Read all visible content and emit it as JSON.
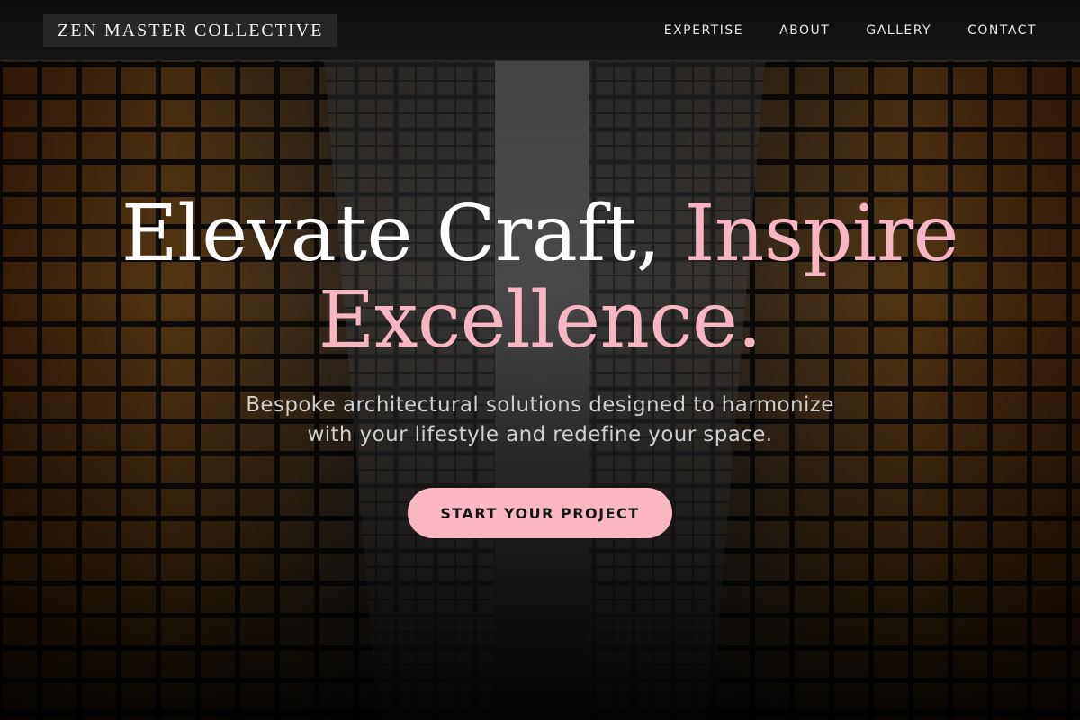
{
  "brand": {
    "name": "ZEN MASTER COLLECTIVE"
  },
  "nav": {
    "items": [
      {
        "label": "EXPERTISE"
      },
      {
        "label": "ABOUT"
      },
      {
        "label": "GALLERY"
      },
      {
        "label": "CONTACT"
      }
    ]
  },
  "hero": {
    "headline_line1": "Elevate Craft,",
    "headline_accent_1": "Inspire",
    "headline_accent_2": "Excellence.",
    "subtitle": "Bespoke architectural solutions designed to harmonize with your lifestyle and redefine your space.",
    "cta_label": "START YOUR PROJECT",
    "background_image": "upward view between two glass-and-steel skyscrapers"
  },
  "colors": {
    "accent_pink": "#f7b6c2",
    "button_pink": "#fbb8c4",
    "nav_bg": "#111111",
    "text_white": "#ffffff"
  }
}
